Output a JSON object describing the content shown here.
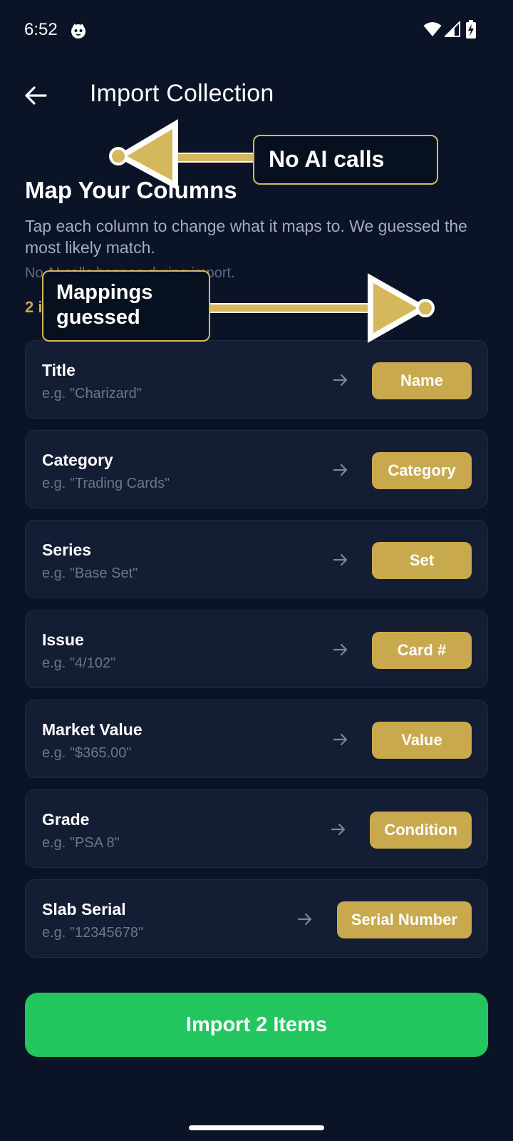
{
  "status_bar": {
    "time": "6:52"
  },
  "header": {
    "title": "Import Collection"
  },
  "section": {
    "title": "Map Your Columns",
    "description": "Tap each column to change what it maps to. We guessed the most likely match.",
    "privacy_note": "No AI calls happen during import.",
    "items_count": "2 items"
  },
  "mappings": [
    {
      "name": "Title",
      "example": "e.g. \"Charizard\"",
      "target": "Name"
    },
    {
      "name": "Category",
      "example": "e.g. \"Trading Cards\"",
      "target": "Category"
    },
    {
      "name": "Series",
      "example": "e.g. \"Base Set\"",
      "target": "Set"
    },
    {
      "name": "Issue",
      "example": "e.g. \"4/102\"",
      "target": "Card #"
    },
    {
      "name": "Market Value",
      "example": "e.g. \"$365.00\"",
      "target": "Value"
    },
    {
      "name": "Grade",
      "example": "e.g. \"PSA 8\"",
      "target": "Condition"
    },
    {
      "name": "Slab Serial",
      "example": "e.g. \"12345678\"",
      "target": "Serial Number"
    }
  ],
  "import_button": {
    "label": "Import 2 Items"
  },
  "annotations": {
    "ai_calls": "No AI calls",
    "mappings_guessed": "Mappings guessed"
  },
  "colors": {
    "background": "#0b1426",
    "card": "#131d33",
    "accent_gold": "#c9a94e",
    "button_green": "#22c55e"
  }
}
